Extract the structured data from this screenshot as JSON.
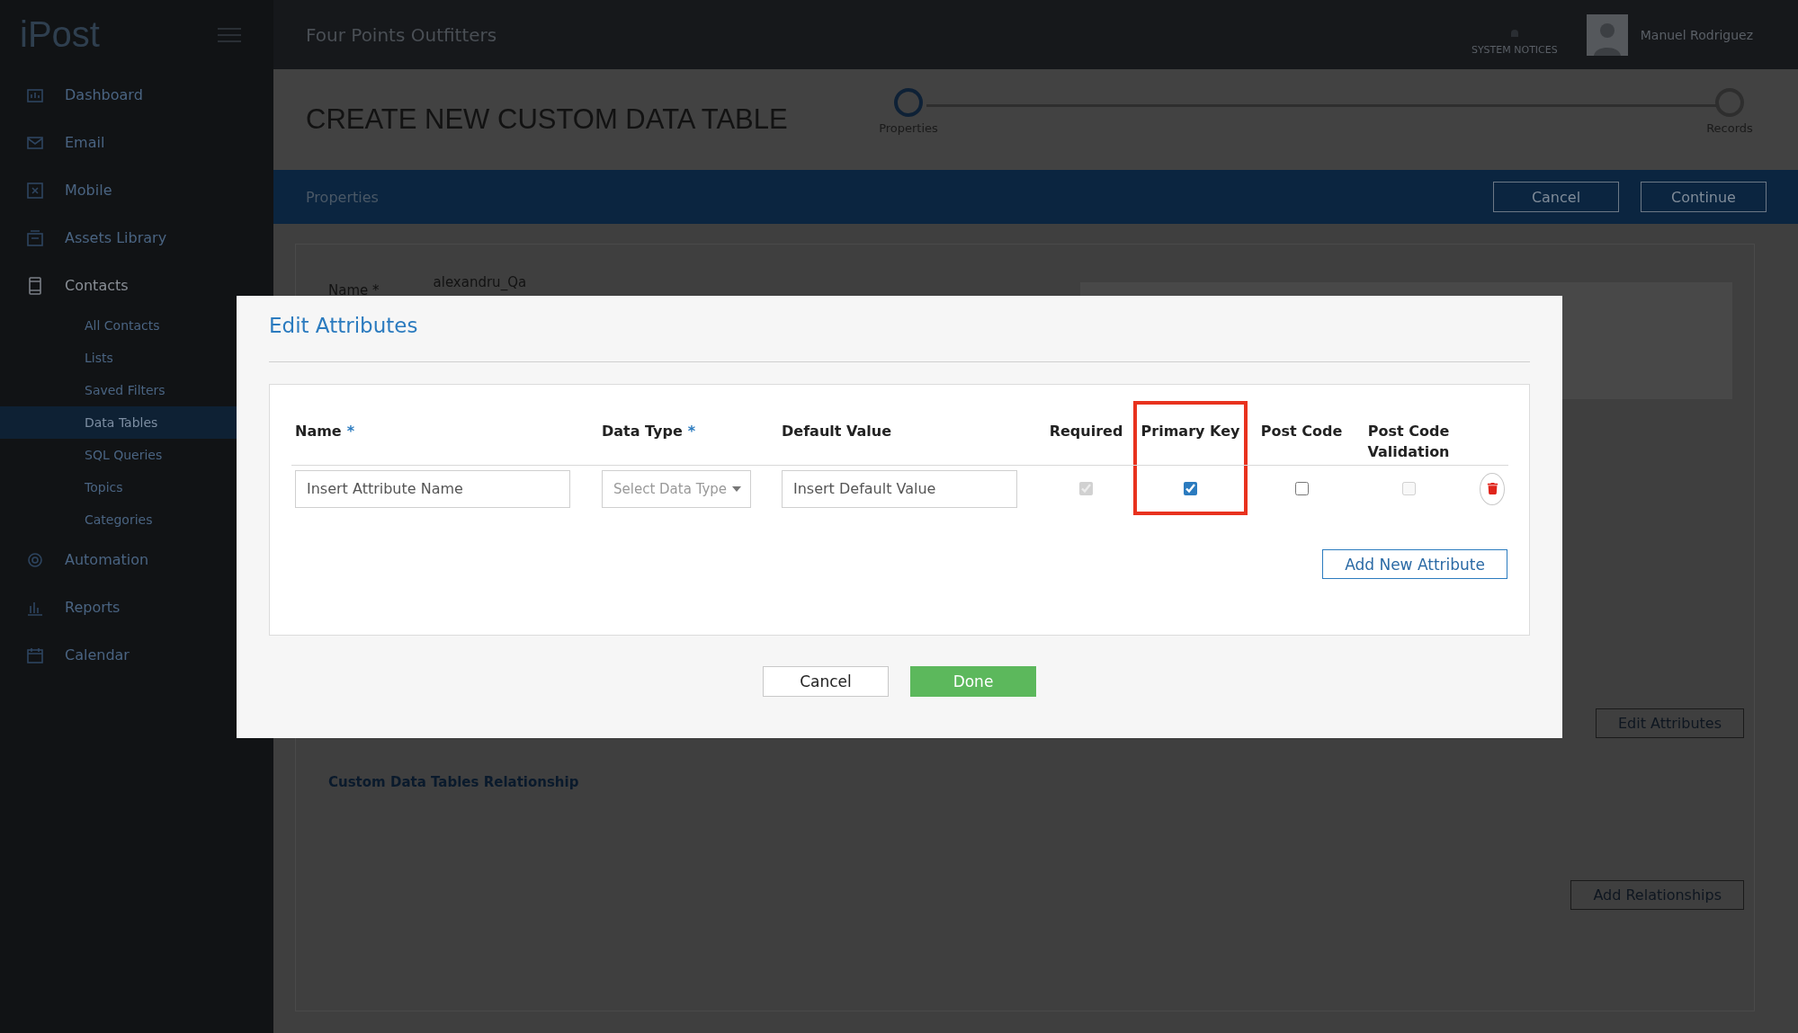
{
  "app": {
    "logo": "iPost",
    "account": "Four Points Outfitters",
    "notices": "SYSTEM NOTICES",
    "user": "Manuel Rodriguez"
  },
  "sidebar": {
    "items": [
      {
        "label": "Dashboard",
        "expanded": false,
        "selected": false
      },
      {
        "label": "Email",
        "expanded": false,
        "selected": false
      },
      {
        "label": "Mobile",
        "expanded": false,
        "selected": false
      },
      {
        "label": "Assets Library",
        "expanded": false,
        "selected": false
      },
      {
        "label": "Contacts",
        "expanded": true,
        "selected": false,
        "children": [
          {
            "label": "All Contacts",
            "selected": false
          },
          {
            "label": "Lists",
            "selected": false
          },
          {
            "label": "Saved Filters",
            "selected": false
          },
          {
            "label": "Data Tables",
            "selected": true
          },
          {
            "label": "SQL Queries",
            "selected": false
          },
          {
            "label": "Topics",
            "selected": false
          },
          {
            "label": "Categories",
            "selected": false
          }
        ]
      },
      {
        "label": "Automation",
        "expanded": false,
        "selected": false
      },
      {
        "label": "Reports",
        "expanded": false,
        "selected": false
      },
      {
        "label": "Calendar",
        "expanded": false,
        "selected": false
      }
    ]
  },
  "page": {
    "title": "CREATE NEW CUSTOM DATA TABLE",
    "steps": [
      {
        "label": "Properties",
        "selected": true
      },
      {
        "label": "Records",
        "selected": false
      }
    ],
    "section": "Properties",
    "buttons": [
      "Cancel",
      "Continue"
    ],
    "name_label": "Name *",
    "name_value": "alexandru_Qa",
    "edit_button": "Edit Attributes",
    "relationship_heading": "Custom Data Tables Relationship",
    "relationship_button": "Add Relationships"
  },
  "dialog": {
    "title": "Edit Attributes",
    "columns": [
      {
        "label": "Name",
        "required": true,
        "highlighted": false
      },
      {
        "label": "Data Type",
        "required": true,
        "highlighted": false
      },
      {
        "label": "Default Value",
        "required": false,
        "highlighted": false
      },
      {
        "label": "Required",
        "required": false,
        "highlighted": false
      },
      {
        "label": "Primary Key",
        "required": false,
        "highlighted": true
      },
      {
        "label": "Post Code",
        "required": false,
        "highlighted": false
      },
      {
        "label": "Post Code Validation",
        "required": false,
        "highlighted": false
      }
    ],
    "rows": [
      {
        "cells": [
          {
            "kind": "text",
            "placeholder": "Insert Attribute Name"
          },
          {
            "kind": "select",
            "placeholder": "Select Data Type"
          },
          {
            "kind": "text",
            "placeholder": "Insert Default Value"
          },
          {
            "kind": "checkbox",
            "checked": true,
            "disabled": true
          },
          {
            "kind": "checkbox",
            "checked": true,
            "disabled": false
          },
          {
            "kind": "checkbox",
            "checked": false,
            "disabled": false
          },
          {
            "kind": "checkbox",
            "checked": false,
            "disabled": true
          }
        ]
      }
    ],
    "add_button": "Add New Attribute",
    "required_mark": "*",
    "buttons": [
      {
        "label": "Cancel",
        "kind": "secondary"
      },
      {
        "label": "Done",
        "kind": "primary"
      }
    ]
  }
}
